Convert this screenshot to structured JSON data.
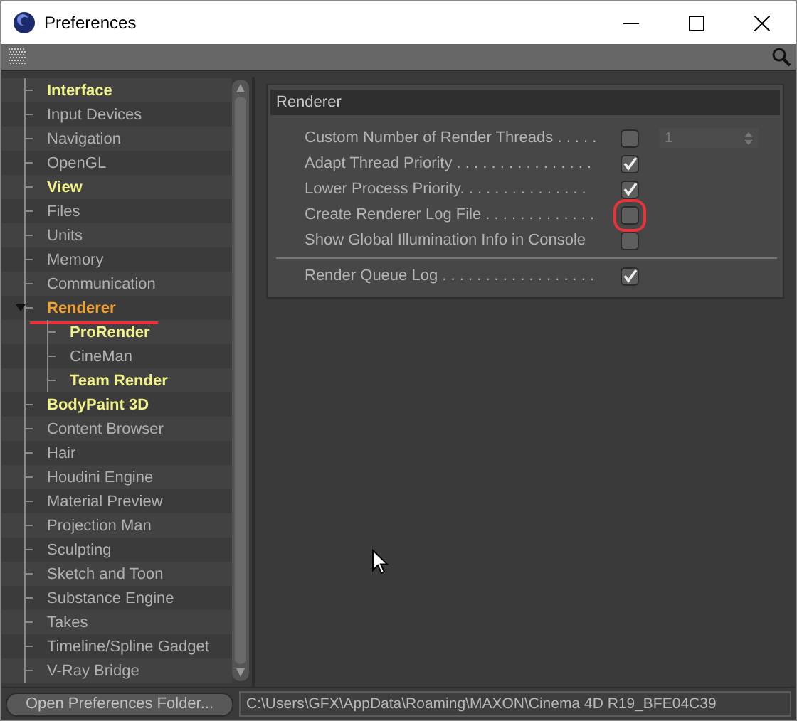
{
  "window": {
    "title": "Preferences"
  },
  "sidebar": {
    "items": [
      {
        "label": "Interface",
        "bold": true,
        "selected": false
      },
      {
        "label": "Input Devices",
        "bold": false,
        "selected": false
      },
      {
        "label": "Navigation",
        "bold": false,
        "selected": false
      },
      {
        "label": "OpenGL",
        "bold": false,
        "selected": false
      },
      {
        "label": "View",
        "bold": true,
        "selected": false
      },
      {
        "label": "Files",
        "bold": false,
        "selected": false
      },
      {
        "label": "Units",
        "bold": false,
        "selected": false
      },
      {
        "label": "Memory",
        "bold": false,
        "selected": false
      },
      {
        "label": "Communication",
        "bold": false,
        "selected": false
      },
      {
        "label": "Renderer",
        "bold": true,
        "selected": true,
        "expanded": true,
        "marked": true,
        "children": [
          {
            "label": "ProRender",
            "bold": true,
            "selected": false
          },
          {
            "label": "CineMan",
            "bold": false,
            "selected": false
          },
          {
            "label": "Team Render",
            "bold": true,
            "selected": false
          }
        ]
      },
      {
        "label": "BodyPaint 3D",
        "bold": true,
        "selected": false
      },
      {
        "label": "Content Browser",
        "bold": false,
        "selected": false
      },
      {
        "label": "Hair",
        "bold": false,
        "selected": false
      },
      {
        "label": "Houdini Engine",
        "bold": false,
        "selected": false
      },
      {
        "label": "Material Preview",
        "bold": false,
        "selected": false
      },
      {
        "label": "Projection Man",
        "bold": false,
        "selected": false
      },
      {
        "label": "Sculpting",
        "bold": false,
        "selected": false
      },
      {
        "label": "Sketch and Toon",
        "bold": false,
        "selected": false
      },
      {
        "label": "Substance Engine",
        "bold": false,
        "selected": false
      },
      {
        "label": "Takes",
        "bold": false,
        "selected": false
      },
      {
        "label": "Timeline/Spline Gadget",
        "bold": false,
        "selected": false
      },
      {
        "label": "V-Ray Bridge",
        "bold": false,
        "selected": false
      }
    ]
  },
  "panel": {
    "title": "Renderer",
    "settings": [
      {
        "kind": "checkbox",
        "label": "Custom Number of Render Threads . . . . .",
        "checked": false,
        "value": "1",
        "disabled": true
      },
      {
        "kind": "checkbox",
        "label": "Adapt Thread Priority . . . . . . . . . . . . . . . .",
        "checked": true
      },
      {
        "kind": "checkbox",
        "label": "Lower Process Priority. . . . . . . . . . . . . . .",
        "checked": true
      },
      {
        "kind": "checkbox",
        "label": "Create Renderer Log File . . . . . . . . . . . . .",
        "checked": false,
        "marked": true
      },
      {
        "kind": "checkbox",
        "label": "Show Global Illumination Info in Console",
        "checked": false
      },
      {
        "kind": "separator"
      },
      {
        "kind": "checkbox",
        "label": "Render Queue Log . . . . . . . . . . . . . . . . . .",
        "checked": true
      }
    ]
  },
  "footer": {
    "button": "Open Preferences Folder...",
    "path": "C:\\Users\\GFX\\AppData\\Roaming\\MAXON\\Cinema 4D R19_BFE04C39"
  }
}
